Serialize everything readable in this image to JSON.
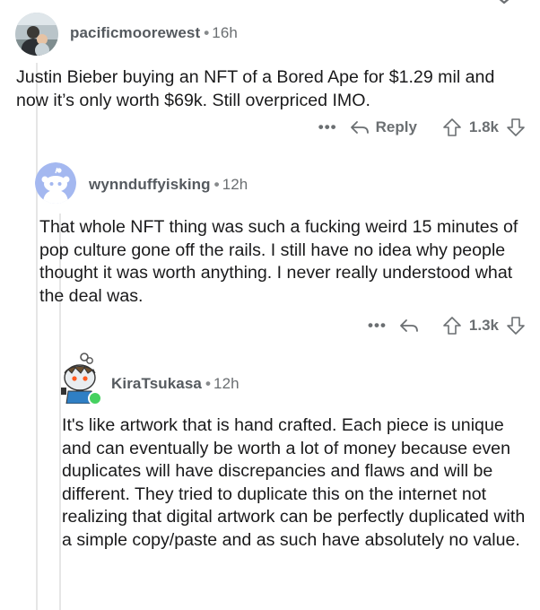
{
  "comments": [
    {
      "username": "pacificmoorewest",
      "separator": "•",
      "time": "16h",
      "text": "Justin Bieber buying an NFT of a Bored Ape for $1.29 mil and now it’s only worth $69k. Still overpriced IMO.",
      "reply_label": "Reply",
      "score": "1.8k"
    },
    {
      "username": "wynnduffyisking",
      "separator": "•",
      "time": "12h",
      "text": "That whole NFT thing was such a fucking weird 15 minutes of pop culture gone off the rails. I still have no idea why people thought it was worth anything. I never really understood what the deal was.",
      "score": "1.3k"
    },
    {
      "username": "KiraTsukasa",
      "separator": "•",
      "time": "12h",
      "text": "It's like artwork that is hand crafted. Each piece is unique and can eventually be worth a lot of money because even duplicates will have discrepancies and flaws and will be different. They tried to duplicate this on the internet not realizing that digital artwork can be perfectly duplicated with a simple copy/paste and as such have absolutely no value."
    }
  ],
  "more_label": "•••",
  "colors": {
    "text": "#1a1a1b",
    "meta": "#6b6f72",
    "online": "#46d160",
    "thread": "#e6e6e6"
  }
}
